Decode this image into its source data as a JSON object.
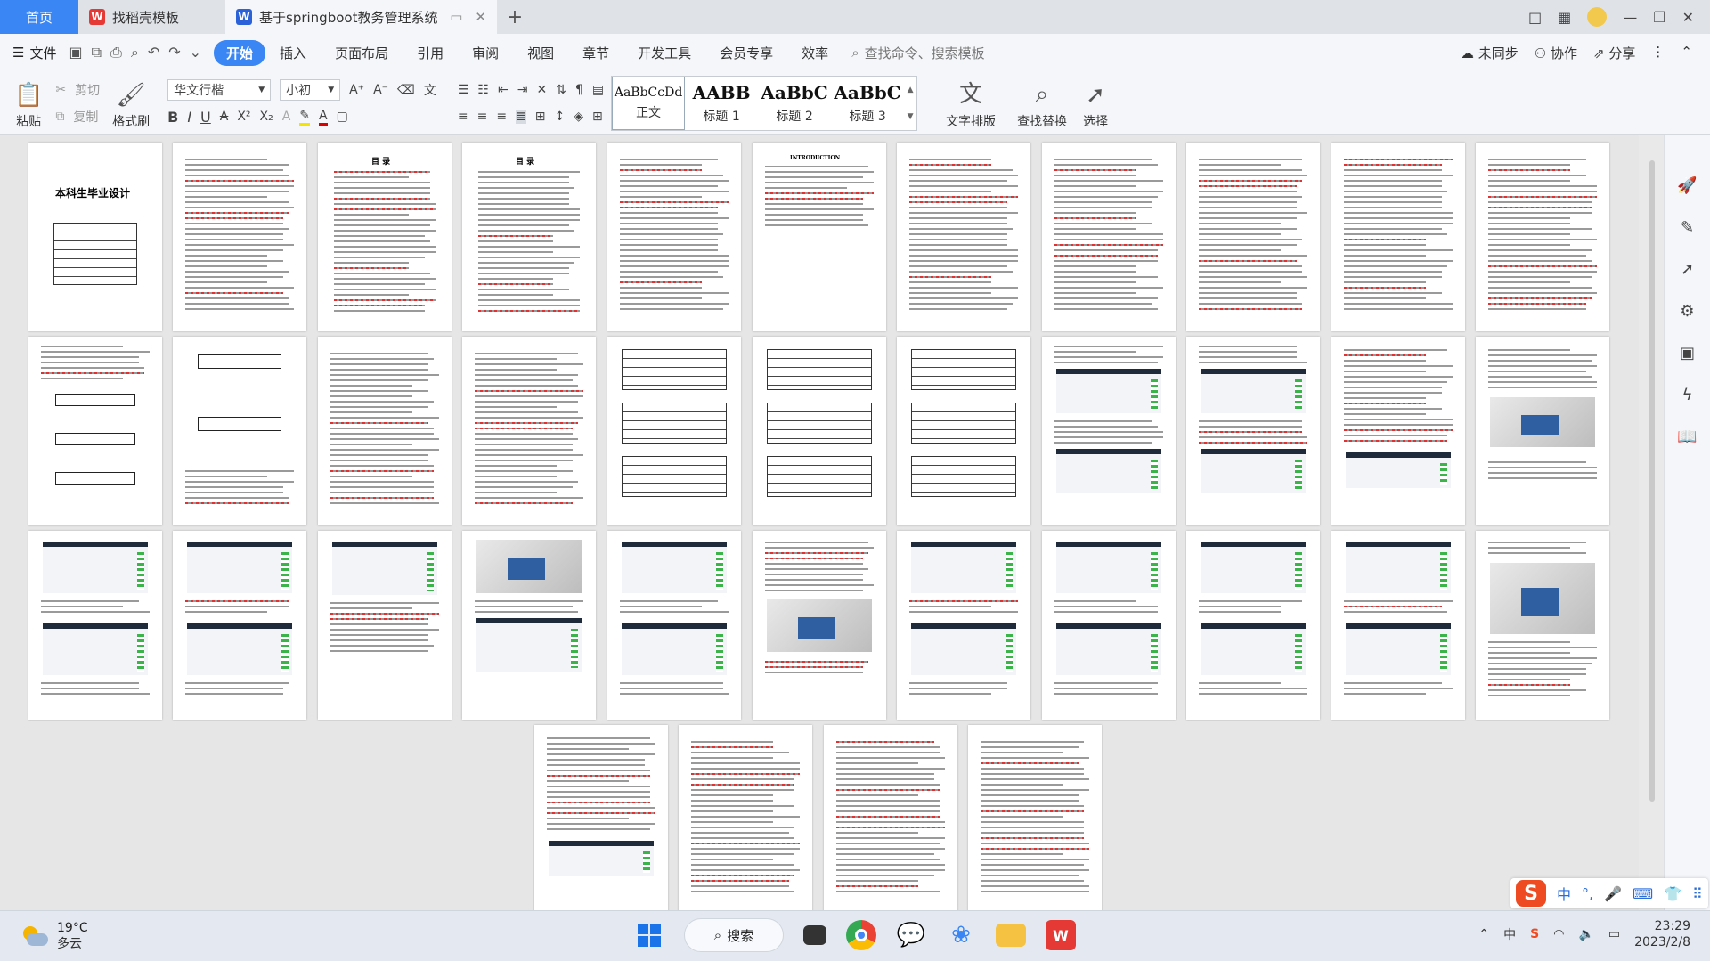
{
  "tabs": [
    {
      "label": "首页"
    },
    {
      "label": "找稻壳模板"
    },
    {
      "label": "基于springboot教务管理系统"
    }
  ],
  "menu": {
    "file": "文件",
    "items": [
      "开始",
      "插入",
      "页面布局",
      "引用",
      "审阅",
      "视图",
      "章节",
      "开发工具",
      "会员专享",
      "效率"
    ],
    "search_placeholder": "查找命令、搜索模板",
    "sync": "未同步",
    "collab": "协作",
    "share": "分享"
  },
  "ribbon": {
    "paste": "粘贴",
    "cut": "剪切",
    "copy": "复制",
    "format_painter": "格式刷",
    "font_name": "华文行楷",
    "font_size": "小初",
    "styles": [
      {
        "sample": "AaBbCcDd",
        "label": "正文"
      },
      {
        "sample": "AABB",
        "label": "标题 1"
      },
      {
        "sample": "AaBbC",
        "label": "标题 2"
      },
      {
        "sample": "AaBbC",
        "label": "标题 3"
      }
    ],
    "text_layout": "文字排版",
    "find_replace": "查找替换",
    "select": "选择"
  },
  "pages": {
    "cover_title": "本科生毕业设计",
    "toc_title": "目  录",
    "abstract_title": "INTRODUCTION"
  },
  "ime": {
    "mode": "中"
  },
  "taskbar": {
    "temp": "19°C",
    "weather": "多云",
    "search": "搜索",
    "time": "23:29",
    "date": "2023/2/8"
  }
}
